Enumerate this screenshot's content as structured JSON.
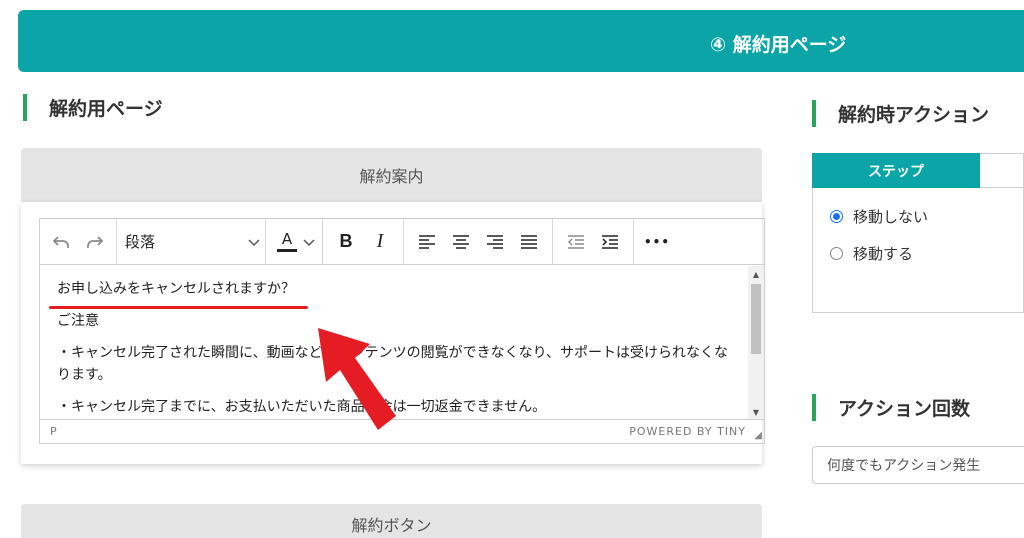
{
  "banner": {
    "title": "④ 解約用ページ"
  },
  "page_section": {
    "title": "解約用ページ"
  },
  "cancel_info_card": {
    "header": "解約案内"
  },
  "editor": {
    "toolbar": {
      "undo_icon": "undo-icon",
      "redo_icon": "redo-icon",
      "format_select": "段落",
      "text_color_label": "A",
      "bold_label": "B",
      "italic_label": "I",
      "more_label": "•••"
    },
    "content": {
      "line1": "お申し込みをキャンセルされますか？",
      "line2": "ご注意",
      "line3": "・キャンセル完了された瞬間に、動画などのコンテンツの閲覧ができなくなり、サポートは受けられなくなります。",
      "line4": "・キャンセル完了までに、お支払いただいた商品代金は一切返金できません。"
    },
    "statusbar": {
      "path": "P",
      "powered": "POWERED BY TINY"
    }
  },
  "cancel_button_card": {
    "header": "解約ボタン"
  },
  "cancel_action": {
    "title": "解約時アクション",
    "tab_active": "ステップ",
    "options": [
      "移動しない",
      "移動する"
    ],
    "selected_option": "移動しない"
  },
  "action_count": {
    "title": "アクション回数",
    "select_value": "何度でもアクション発生"
  },
  "colors": {
    "primary": "#0ba5a8",
    "heading_bar": "#27a55a",
    "annotation": "#e51c23"
  }
}
